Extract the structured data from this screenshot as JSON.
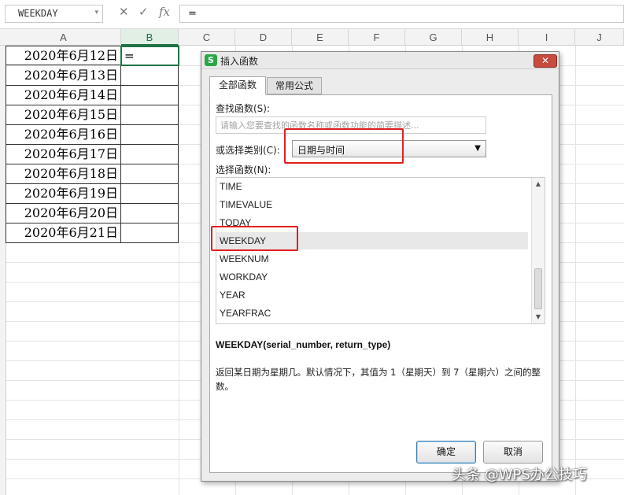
{
  "formula_bar": {
    "name_box": "WEEKDAY",
    "cancel_icon": "✕",
    "enter_icon": "✓",
    "fx_icon": "fx",
    "content": "="
  },
  "columns": [
    "A",
    "B",
    "C",
    "D",
    "E",
    "F",
    "G",
    "H",
    "I",
    "J"
  ],
  "dates": [
    "2020年6月12日",
    "2020年6月13日",
    "2020年6月14日",
    "2020年6月15日",
    "2020年6月16日",
    "2020年6月17日",
    "2020年6月18日",
    "2020年6月19日",
    "2020年6月20日",
    "2020年6月21日"
  ],
  "active_cell": {
    "content": "="
  },
  "dialog": {
    "title": "插入函数",
    "close": "✕",
    "tabs": [
      "全部函数",
      "常用公式"
    ],
    "search_label": "查找函数(S):",
    "search_placeholder": "请输入您要查找的函数名称或函数功能的简要描述...",
    "category_label": "或选择类别(C):",
    "category_value": "日期与时间",
    "function_label": "选择函数(N):",
    "functions": [
      "TIME",
      "TIMEVALUE",
      "TODAY",
      "WEEKDAY",
      "WEEKNUM",
      "WORKDAY",
      "YEAR",
      "YEARFRAC"
    ],
    "selected_function": "WEEKDAY",
    "signature": "WEEKDAY(serial_number, return_type)",
    "description": "返回某日期为星期几。默认情况下，其值为 1（星期天）到 7（星期六）之间的整数。",
    "ok": "确定",
    "cancel": "取消"
  },
  "watermark": "头条 @WPS办公技巧",
  "colors": {
    "highlight": "#e21f1f",
    "active_cell": "#217346"
  }
}
